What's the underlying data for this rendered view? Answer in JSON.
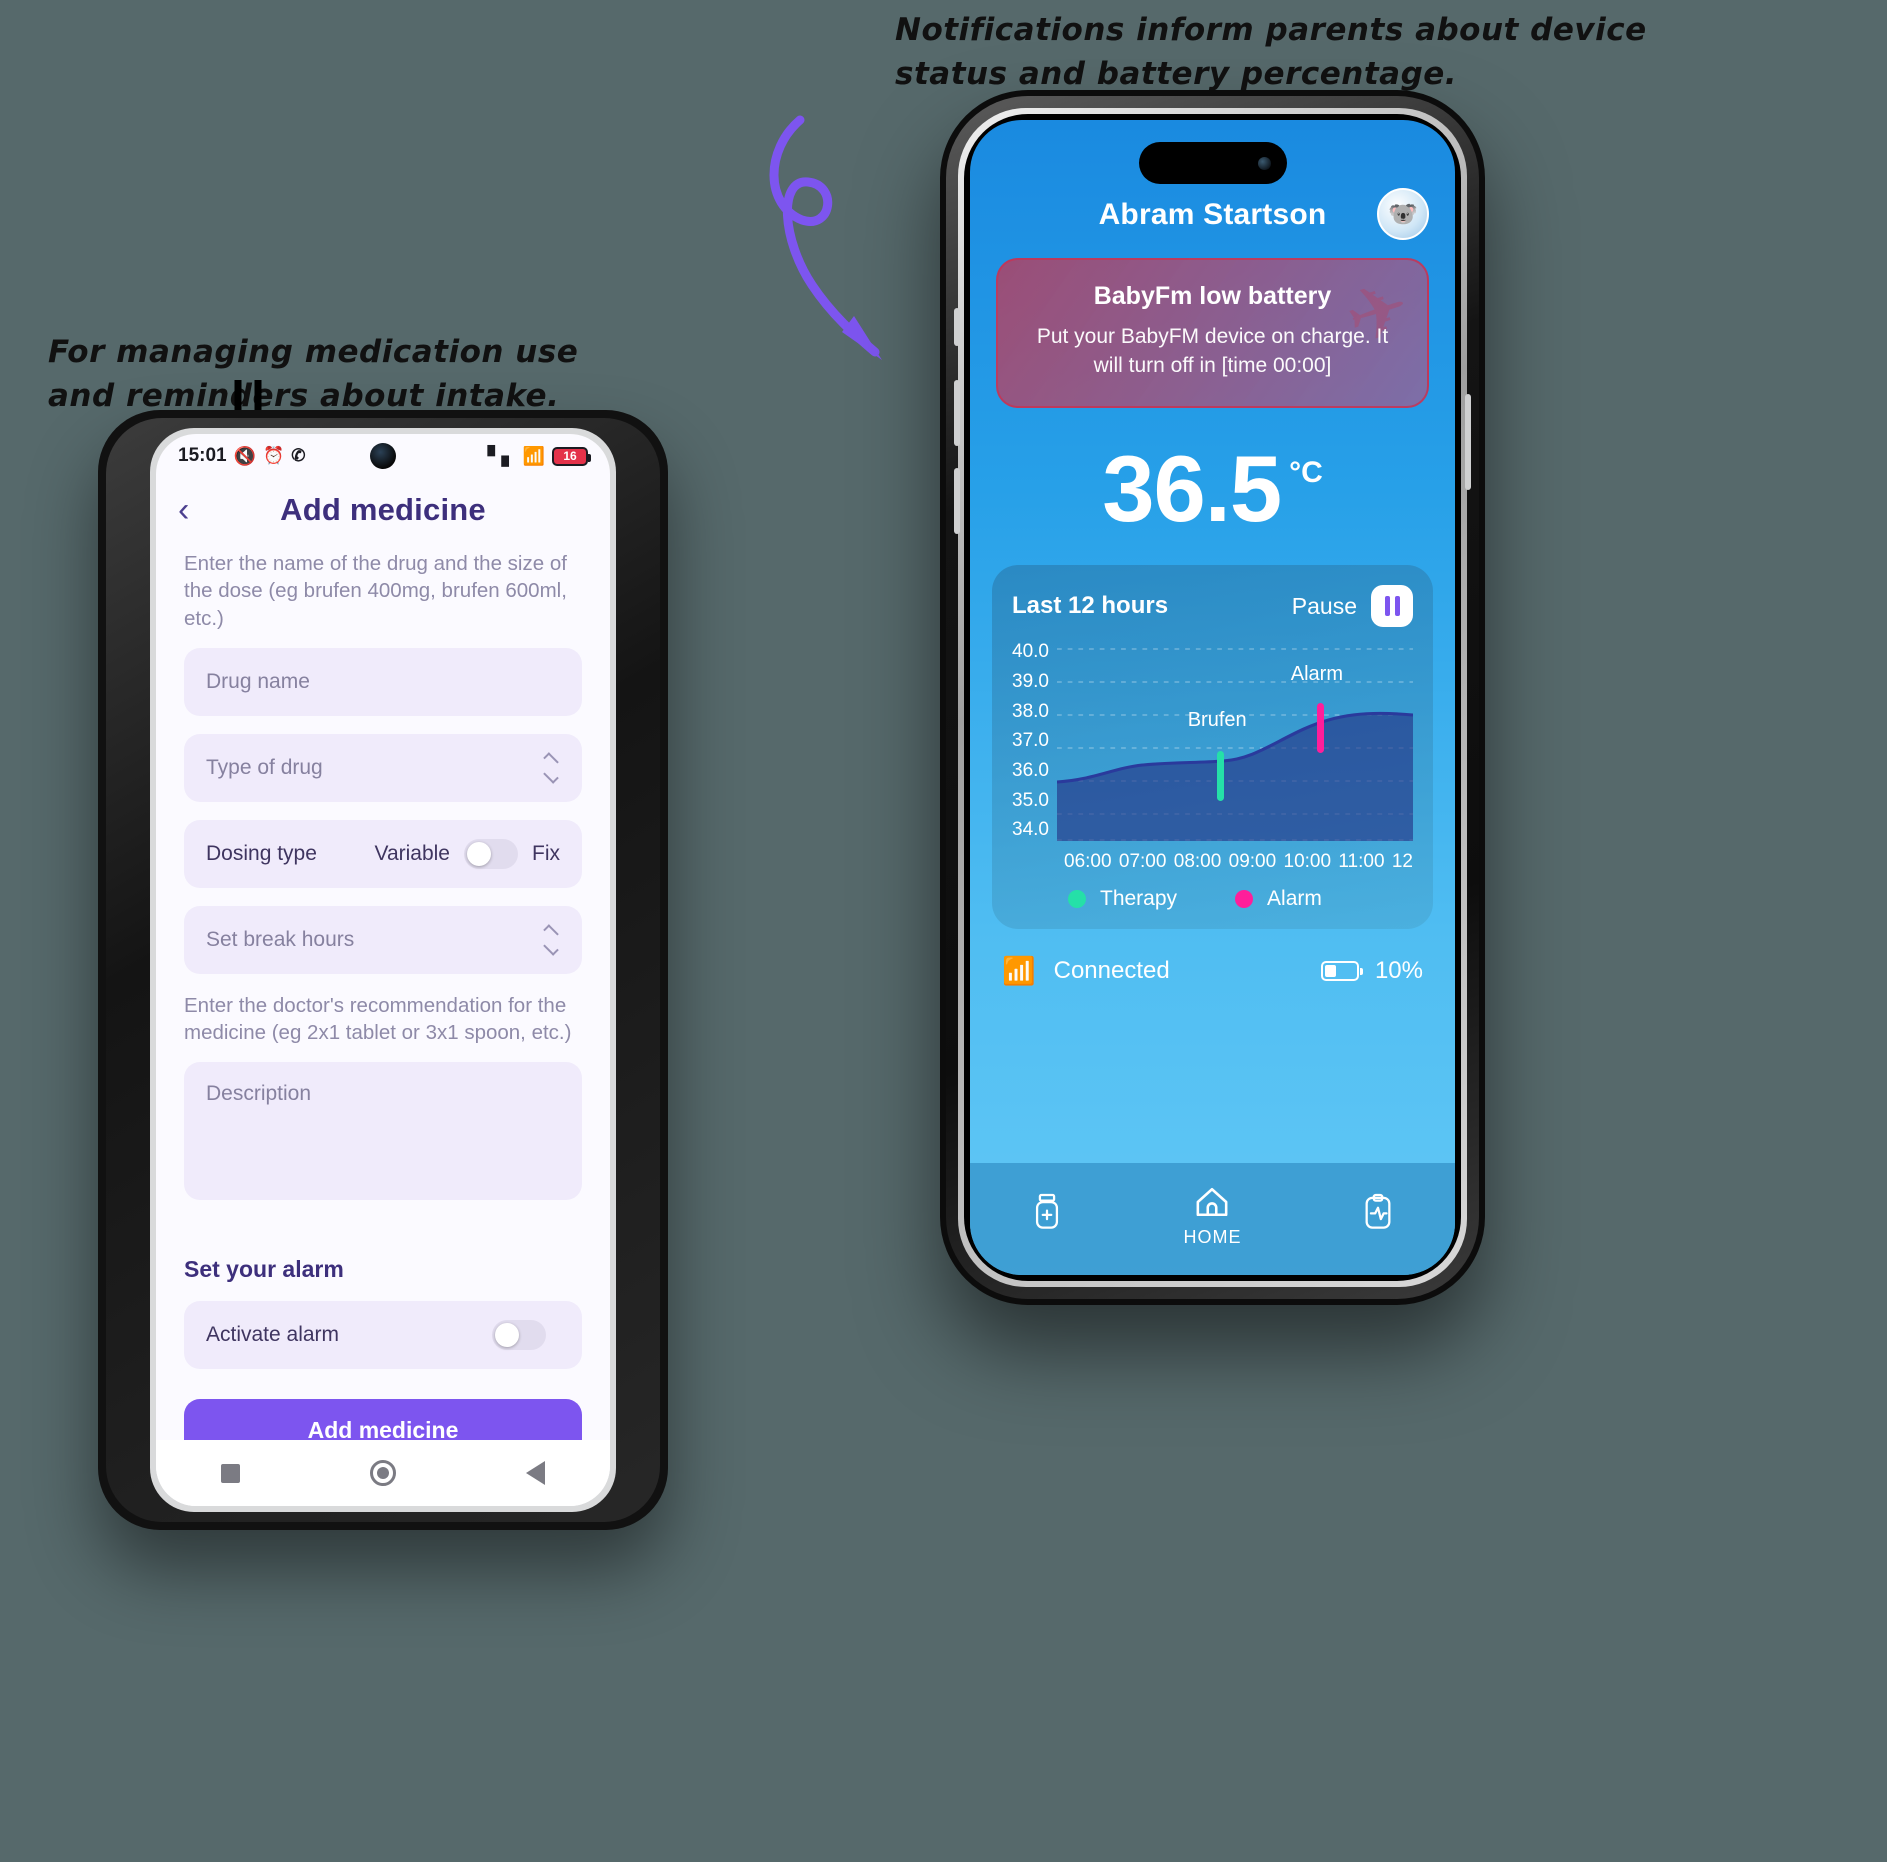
{
  "annotations": {
    "left": "For managing medication use\nand reminders about intake.",
    "right": "Notifications inform parents about device\nstatus and battery percentage."
  },
  "android": {
    "status_bar": {
      "time": "15:01",
      "icons_left": [
        "mute-icon",
        "alarm-icon",
        "viber-icon"
      ],
      "signal": "signal-icon",
      "wifi": "wifi-icon",
      "battery_percent": "16"
    },
    "appbar": {
      "back_icon": "chevron-left-icon",
      "title": "Add medicine"
    },
    "helper_1": "Enter the name of the drug and the size of the dose (eg brufen 400mg, brufen 600ml, etc.)",
    "fields": {
      "drug_name_placeholder": "Drug name",
      "type_of_drug_placeholder": "Type of drug",
      "dosing_type_label": "Dosing type",
      "dosing_variable": "Variable",
      "dosing_fix": "Fix",
      "break_hours_placeholder": "Set break hours"
    },
    "helper_2": "Enter the doctor's recommendation for the medicine (eg 2x1 tablet or 3x1 spoon, etc.)",
    "description_placeholder": "Description",
    "alarm_section_title": "Set your alarm",
    "activate_alarm_label": "Activate alarm",
    "submit_label": "Add medicine",
    "nav": [
      "square-icon",
      "circle-icon",
      "triangle-back-icon"
    ],
    "colors": {
      "accent": "#7d55ef",
      "field_bg": "#f0ebfb",
      "title": "#3d2f7c"
    }
  },
  "ios": {
    "header": {
      "name": "Abram Startson",
      "avatar": "koala-avatar"
    },
    "notification": {
      "title": "BabyFm low battery",
      "body": "Put your BabyFM device on charge. It will turn off in [time 00:00]"
    },
    "temperature": {
      "value": "36.5",
      "unit": "°C"
    },
    "chart_card": {
      "title": "Last 12 hours",
      "pause_label": "Pause",
      "pause_icon": "pause-icon"
    },
    "status": {
      "bluetooth_icon": "bluetooth-icon",
      "connection_label": "Connected",
      "battery_icon": "battery-icon",
      "battery_percent": "10%"
    },
    "tabs": [
      {
        "icon": "pill-bottle-icon",
        "label": ""
      },
      {
        "icon": "home-icon",
        "label": "HOME"
      },
      {
        "icon": "clipboard-pulse-icon",
        "label": ""
      }
    ],
    "colors": {
      "screen_top": "#1a8ae0",
      "screen_bottom": "#62c8f5",
      "alarm": "#ff1e9a",
      "therapy": "#25e0a8"
    }
  },
  "chart_data": {
    "type": "area",
    "title": "Last 12 hours",
    "xlabel": "",
    "ylabel": "",
    "ylim": [
      34.0,
      40.0
    ],
    "yticks": [
      "40.0",
      "39.0",
      "38.0",
      "37.0",
      "36.0",
      "35.0",
      "34.0"
    ],
    "xticks": [
      "06:00",
      "07:00",
      "08:00",
      "09:00",
      "10:00",
      "11:00",
      "12"
    ],
    "grid": true,
    "legend_position": "bottom-left",
    "legend": [
      {
        "name": "Therapy",
        "color": "#25e0a8"
      },
      {
        "name": "Alarm",
        "color": "#ff1e9a"
      }
    ],
    "series": [
      {
        "name": "Temperature",
        "x": [
          "06:00",
          "06:30",
          "07:00",
          "07:30",
          "08:00",
          "08:30",
          "09:00",
          "09:30",
          "10:00",
          "10:30",
          "11:00",
          "11:30",
          "12:00"
        ],
        "values": [
          36.0,
          36.2,
          36.5,
          36.6,
          36.6,
          36.6,
          36.7,
          36.9,
          37.3,
          37.7,
          37.9,
          38.0,
          37.9
        ]
      }
    ],
    "annotations": [
      {
        "label": "Brufen",
        "x": "09:00",
        "y": 36.9,
        "color": "#25e0a8"
      },
      {
        "label": "Alarm",
        "x": "11:00",
        "y": 37.8,
        "color": "#ff1e9a"
      }
    ]
  }
}
